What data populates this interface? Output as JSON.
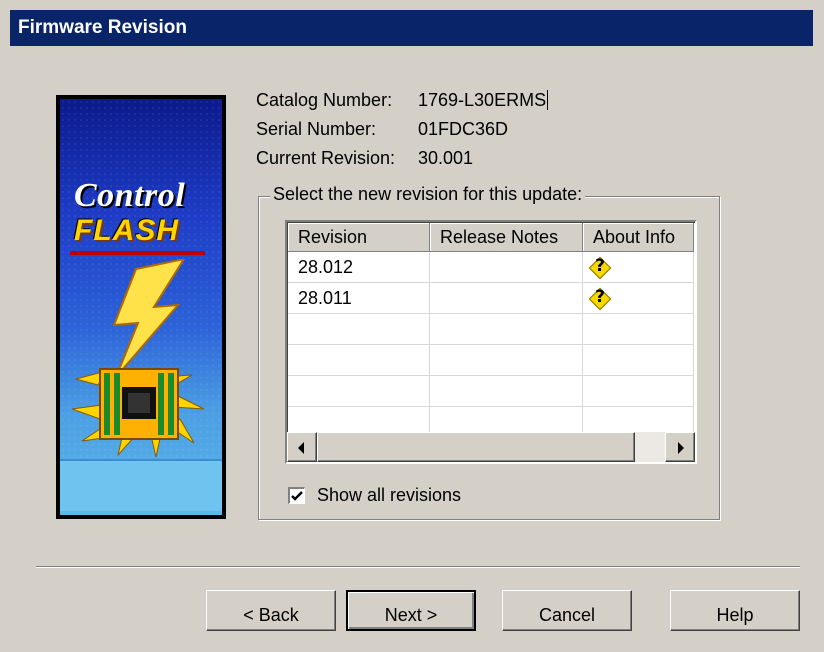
{
  "window": {
    "title": "Firmware Revision"
  },
  "logo": {
    "line1": "Control",
    "line2": "FLASH"
  },
  "info": {
    "catalog_label": "Catalog Number:",
    "catalog_value": "1769-L30ERMS",
    "serial_label": "Serial Number:",
    "serial_value": "01FDC36D",
    "current_label": "Current Revision:",
    "current_value": "30.001"
  },
  "revisions": {
    "group_label": "Select the new revision for this update:",
    "columns": [
      "Revision",
      "Release Notes",
      "About Info"
    ],
    "rows": [
      {
        "revision": "28.012",
        "release_notes": "",
        "about_info_icon": "help-question-icon"
      },
      {
        "revision": "28.011",
        "release_notes": "",
        "about_info_icon": "help-question-icon"
      },
      {
        "revision": "",
        "release_notes": ""
      },
      {
        "revision": "",
        "release_notes": ""
      },
      {
        "revision": "",
        "release_notes": ""
      },
      {
        "revision": "",
        "release_notes": ""
      }
    ],
    "show_all": {
      "label": "Show all revisions",
      "checked": true
    }
  },
  "buttons": {
    "back": "< Back",
    "next": "Next >",
    "cancel": "Cancel",
    "help": "Help"
  },
  "colors": {
    "titlebar": "#0a246a",
    "dialog_bg": "#d4d0c8",
    "help_icon": "#f4d800"
  }
}
